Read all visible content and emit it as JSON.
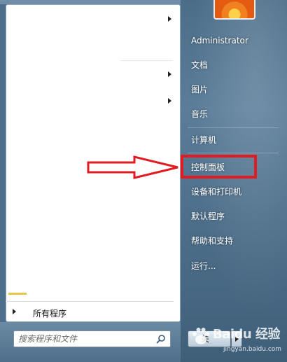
{
  "left_pane": {
    "all_programs_label": "所有程序",
    "search": {
      "placeholder": "搜索程序和文件",
      "value": ""
    }
  },
  "right_pane": {
    "user_name": "Administrator",
    "items": [
      {
        "label": "文档"
      },
      {
        "label": "图片"
      },
      {
        "label": "音乐"
      },
      {
        "label": "计算机"
      },
      {
        "label": "控制面板"
      },
      {
        "label": "设备和打印机"
      },
      {
        "label": "默认程序"
      },
      {
        "label": "帮助和支持"
      },
      {
        "label": "运行..."
      }
    ],
    "shutdown_label": "关"
  },
  "watermark": {
    "brand": "Baidu 经验",
    "url": "jingyan.baidu.com"
  },
  "colors": {
    "highlight": "#e11b22",
    "accent": "#4d6f8c"
  },
  "icons": [
    "submenu-arrow-icon",
    "search-icon",
    "red-arrow-icon",
    "baidu-paw-icon"
  ]
}
